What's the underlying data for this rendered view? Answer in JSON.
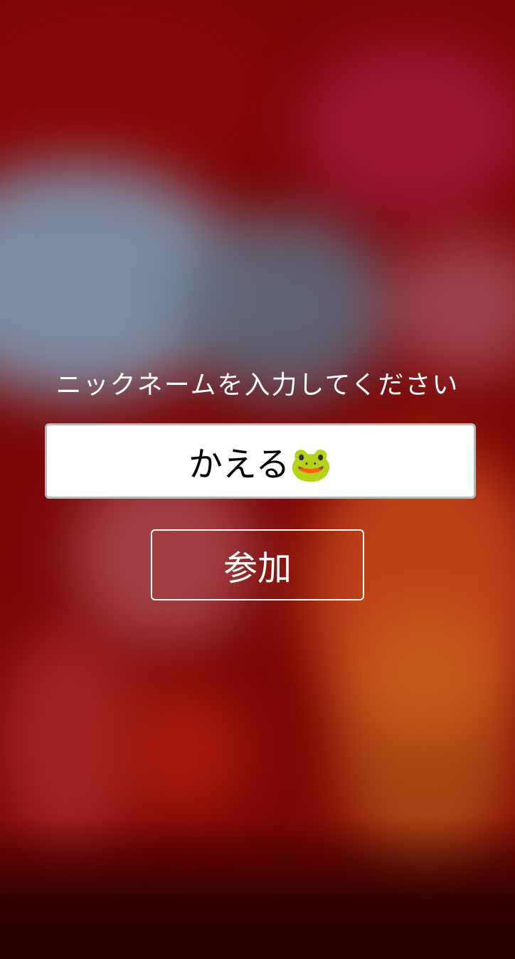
{
  "screen": {
    "prompt": "ニックネームを入力してください",
    "nickname_value": "かえる🐸",
    "join_label": "参加"
  },
  "colors": {
    "background": "#7a0606",
    "text": "#ffffff",
    "input_background": "#ffffff",
    "input_border": "#b9b9b9"
  }
}
